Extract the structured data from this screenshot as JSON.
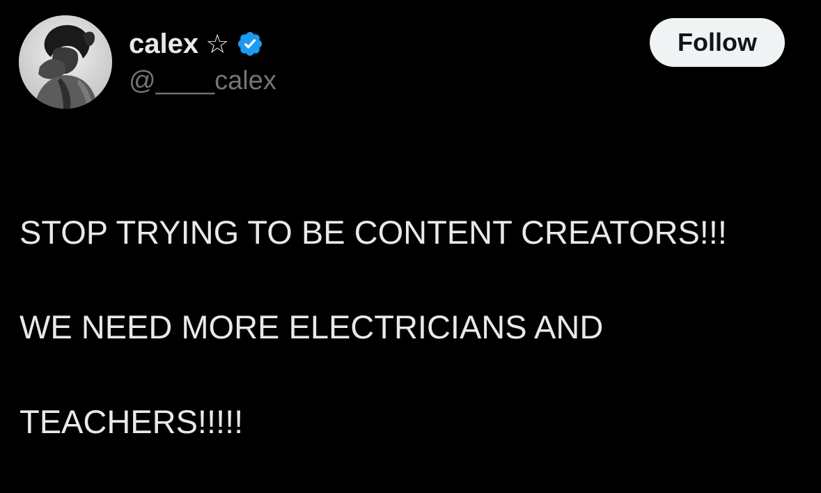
{
  "author": {
    "display_name": "calex",
    "handle": "@____calex",
    "star_icon": "star-outline-icon",
    "verified_icon": "verified-badge-icon",
    "verified_color": "#1d9bf0",
    "avatar_icon": "profile-avatar"
  },
  "actions": {
    "follow_label": "Follow"
  },
  "post": {
    "lines": [
      "STOP TRYING TO BE CONTENT CREATORS!!!",
      "WE NEED MORE ELECTRICIANS AND",
      "TEACHERS!!!!!"
    ]
  },
  "colors": {
    "background": "#000000",
    "text_primary": "#e7e9ea",
    "text_secondary": "#71767b",
    "button_bg": "#eff3f4",
    "button_text": "#0f1419"
  }
}
